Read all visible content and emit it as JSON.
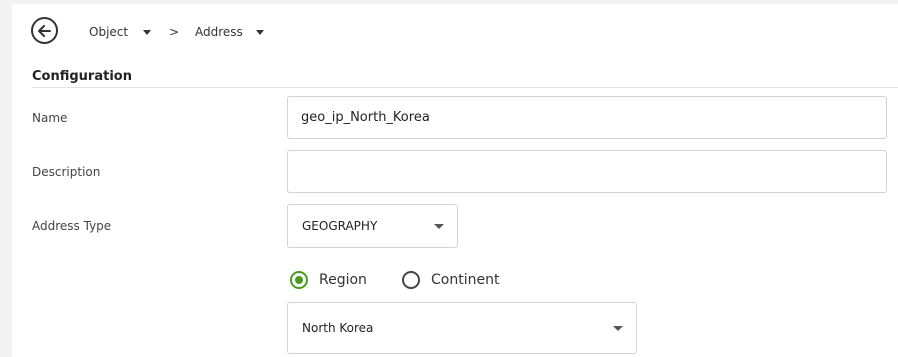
{
  "breadcrumb": {
    "items": [
      "Object",
      "Address"
    ],
    "separator": ">"
  },
  "section": {
    "title": "Configuration"
  },
  "form": {
    "name_label": "Name",
    "name_value": "geo_ip_North_Korea",
    "description_label": "Description",
    "description_value": "",
    "address_type_label": "Address Type",
    "address_type_value": "GEOGRAPHY",
    "radio_options": [
      "Region",
      "Continent"
    ],
    "radio_selected": "Region",
    "region_value": "North Korea"
  },
  "colors": {
    "accent_green": "#4a9a1d"
  },
  "icons": {
    "back": "arrow-left-circle-icon",
    "dropdown": "caret-down-icon"
  }
}
